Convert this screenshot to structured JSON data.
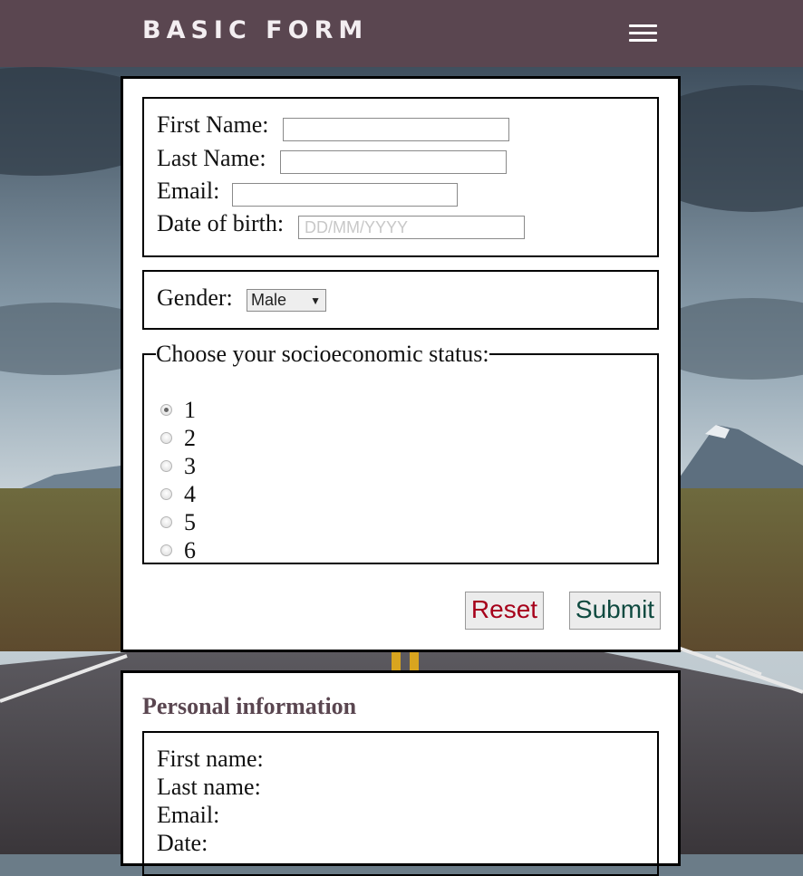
{
  "header": {
    "brand": "BASIC FORM",
    "menu_icon": "hamburger-menu-icon"
  },
  "form": {
    "first_name_label": "First Name:",
    "first_name_value": "",
    "last_name_label": "Last Name:",
    "last_name_value": "",
    "email_label": "Email:",
    "email_value": "",
    "dob_label": "Date of birth:",
    "dob_value": "",
    "dob_placeholder": "DD/MM/YYYY",
    "gender_label": "Gender:",
    "gender_selected": "Male",
    "status_legend": "Choose your socioeconomic status:",
    "status_options": [
      "1",
      "2",
      "3",
      "4",
      "5",
      "6"
    ],
    "status_selected": "1",
    "reset_label": "Reset",
    "submit_label": "Submit"
  },
  "personal_info": {
    "title": "Personal information",
    "first_name_label": "First name:",
    "last_name_label": "Last name:",
    "email_label": "Email:",
    "date_label": "Date:"
  },
  "colors": {
    "header_bg": "#5a4650",
    "reset_text": "#a6001a",
    "submit_text": "#0f4a40",
    "section_title": "#5a4650"
  }
}
